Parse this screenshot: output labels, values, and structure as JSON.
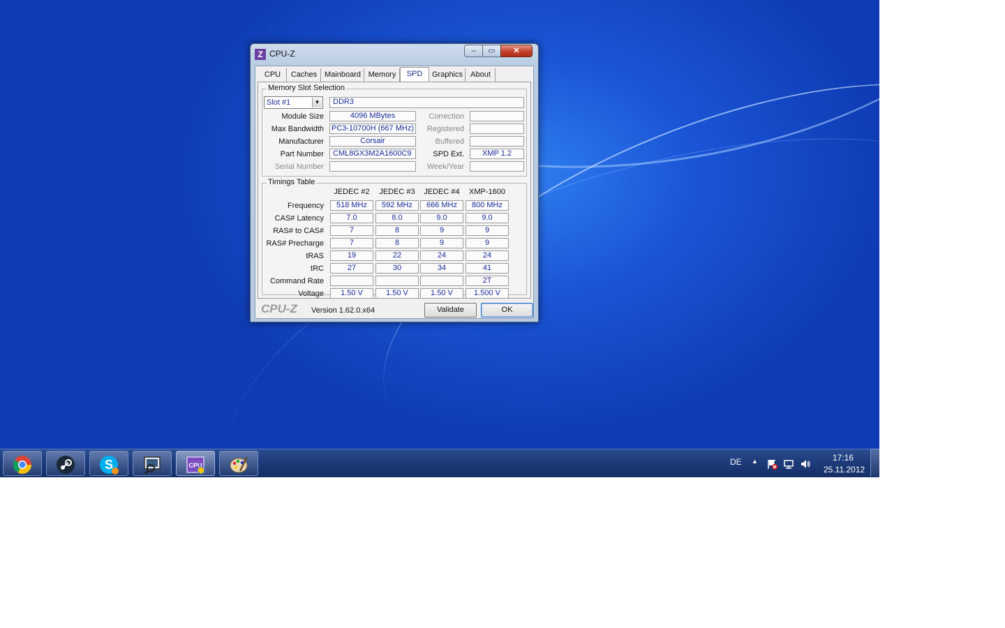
{
  "window": {
    "title": "CPU-Z",
    "icon_letter": "Z",
    "caption_buttons": {
      "minimize": "–",
      "maximize": "▭",
      "close": "✕"
    },
    "tabs": [
      {
        "label": "CPU"
      },
      {
        "label": "Caches"
      },
      {
        "label": "Mainboard"
      },
      {
        "label": "Memory"
      },
      {
        "label": "SPD",
        "selected": true
      },
      {
        "label": "Graphics"
      },
      {
        "label": "About"
      }
    ]
  },
  "spd": {
    "memory_slot_section": {
      "title": "Memory Slot Selection",
      "slot_value": "Slot #1",
      "memory_type": "DDR3",
      "rows": [
        {
          "label": "Module Size",
          "value": "4096 MBytes",
          "right_label": "Correction",
          "right_value": ""
        },
        {
          "label": "Max Bandwidth",
          "value": "PC3-10700H (667 MHz)",
          "right_label": "Registered",
          "right_value": ""
        },
        {
          "label": "Manufacturer",
          "value": "Corsair",
          "right_label": "Buffered",
          "right_value": ""
        },
        {
          "label": "Part Number",
          "value": "CML8GX3M2A1600C9",
          "right_label": "SPD Ext.",
          "right_value": "XMP 1.2"
        },
        {
          "label": "Serial Number",
          "value": "",
          "right_label": "Week/Year",
          "right_value": ""
        }
      ]
    },
    "timings_section": {
      "title": "Timings Table",
      "columns": [
        "JEDEC #2",
        "JEDEC #3",
        "JEDEC #4",
        "XMP-1600"
      ],
      "rows": [
        {
          "label": "Frequency",
          "values": [
            "518 MHz",
            "592 MHz",
            "666 MHz",
            "800 MHz"
          ]
        },
        {
          "label": "CAS# Latency",
          "values": [
            "7.0",
            "8.0",
            "9.0",
            "9.0"
          ]
        },
        {
          "label": "RAS# to CAS#",
          "values": [
            "7",
            "8",
            "9",
            "9"
          ]
        },
        {
          "label": "RAS# Precharge",
          "values": [
            "7",
            "8",
            "9",
            "9"
          ]
        },
        {
          "label": "tRAS",
          "values": [
            "19",
            "22",
            "24",
            "24"
          ]
        },
        {
          "label": "tRC",
          "values": [
            "27",
            "30",
            "34",
            "41"
          ]
        },
        {
          "label": "Command Rate",
          "values": [
            "",
            "",
            "",
            "2T"
          ]
        },
        {
          "label": "Voltage",
          "values": [
            "1.50 V",
            "1.50 V",
            "1.50 V",
            "1.500 V"
          ]
        }
      ]
    }
  },
  "footer": {
    "logo": "CPU-Z",
    "version": "Version 1.62.0.x64",
    "validate_label": "Validate",
    "ok_label": "OK"
  },
  "taskbar": {
    "pinned": [
      {
        "name": "chrome-icon"
      },
      {
        "name": "steam-icon"
      },
      {
        "name": "skype-icon"
      },
      {
        "name": "monitor-tool-icon"
      },
      {
        "name": "cpu-z-icon",
        "active": true
      },
      {
        "name": "paint-icon"
      }
    ],
    "tray": {
      "language": "DE",
      "time": "17:16",
      "date": "25.11.2012"
    }
  }
}
